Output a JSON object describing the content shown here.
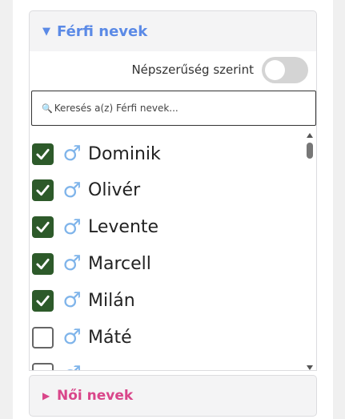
{
  "men_section": {
    "title": "Férfi nevek",
    "expanded": true,
    "arrow_icon": "triangle-down-icon",
    "accent_color": "#5b8ae6"
  },
  "sort": {
    "label": "Népszerűség szerint",
    "enabled": false
  },
  "search": {
    "placeholder": "Keresés a(z) Férfi nevek..."
  },
  "names": [
    {
      "name": "Dominik",
      "checked": true
    },
    {
      "name": "Olivér",
      "checked": true
    },
    {
      "name": "Levente",
      "checked": true
    },
    {
      "name": "Marcell",
      "checked": true
    },
    {
      "name": "Milán",
      "checked": true
    },
    {
      "name": "Máté",
      "checked": false
    },
    {
      "name": "",
      "checked": false
    }
  ],
  "gender_icon": "♂",
  "women_section": {
    "title": "Női nevek",
    "expanded": false,
    "arrow_icon": "triangle-right-icon",
    "accent_color": "#d9468a"
  }
}
